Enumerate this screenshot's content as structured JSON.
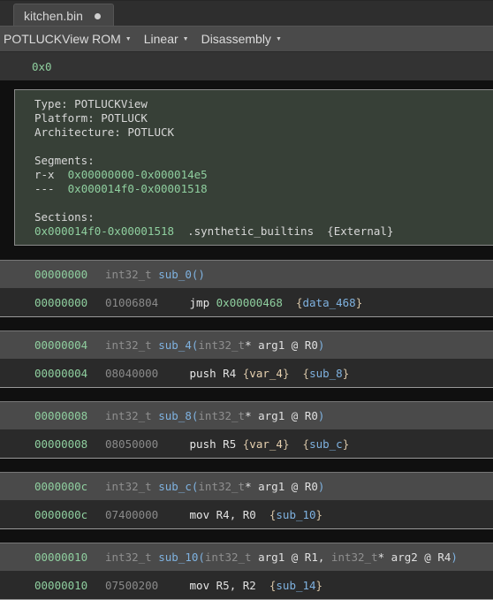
{
  "tab": {
    "title": "kitchen.bin",
    "modified_indicator": "●"
  },
  "toolbar": {
    "view_type": "POTLUCKView ROM",
    "layout": "Linear",
    "mode": "Disassembly",
    "caret": "▼"
  },
  "address_bar": {
    "address": "0x0"
  },
  "info": {
    "type_label": "Type: ",
    "type_value": "POTLUCKView",
    "platform_label": "Platform: ",
    "platform_value": "POTLUCK",
    "arch_label": "Architecture: ",
    "arch_value": "POTLUCK",
    "segments_label": "Segments:",
    "segments": [
      {
        "perm": "r-x",
        "range": "0x00000000-0x000014e5"
      },
      {
        "perm": "---",
        "range": "0x000014f0-0x00001518"
      }
    ],
    "sections_label": "Sections:",
    "sections": [
      {
        "range": "0x000014f0-0x00001518",
        "name": ".synthetic_builtins",
        "attr": "{External}"
      }
    ]
  },
  "functions": [
    {
      "address": "00000000",
      "ret_type": "int32_t ",
      "name": "sub_0",
      "params": "()",
      "instr": {
        "address": "00000000",
        "bytes": "01006804",
        "mnemonic": "jmp ",
        "operand": "0x00000468",
        "annotations": [
          {
            "kind": "sym",
            "text": "data_468"
          }
        ]
      }
    },
    {
      "address": "00000004",
      "ret_type": "int32_t ",
      "name": "sub_4",
      "params": "(int32_t* arg1 @ R0)",
      "instr": {
        "address": "00000004",
        "bytes": "08040000",
        "mnemonic": "push ",
        "operand": "R4",
        "annotations": [
          {
            "kind": "var",
            "text": "var_4"
          },
          {
            "kind": "sym",
            "text": "sub_8"
          }
        ]
      }
    },
    {
      "address": "00000008",
      "ret_type": "int32_t ",
      "name": "sub_8",
      "params": "(int32_t* arg1 @ R0)",
      "instr": {
        "address": "00000008",
        "bytes": "08050000",
        "mnemonic": "push ",
        "operand": "R5",
        "annotations": [
          {
            "kind": "var",
            "text": "var_4"
          },
          {
            "kind": "sym",
            "text": "sub_c"
          }
        ]
      }
    },
    {
      "address": "0000000c",
      "ret_type": "int32_t ",
      "name": "sub_c",
      "params": "(int32_t* arg1 @ R0)",
      "instr": {
        "address": "0000000c",
        "bytes": "07400000",
        "mnemonic": "mov ",
        "operand": "R4, R0",
        "annotations": [
          {
            "kind": "sym",
            "text": "sub_10"
          }
        ]
      }
    },
    {
      "address": "00000010",
      "ret_type": "int32_t ",
      "name": "sub_10",
      "params": "(int32_t arg1 @ R1, int32_t* arg2 @ R4)",
      "instr": {
        "address": "00000010",
        "bytes": "07500200",
        "mnemonic": "mov ",
        "operand": "R5, R2",
        "annotations": [
          {
            "kind": "sym",
            "text": "sub_14"
          }
        ]
      }
    }
  ]
}
